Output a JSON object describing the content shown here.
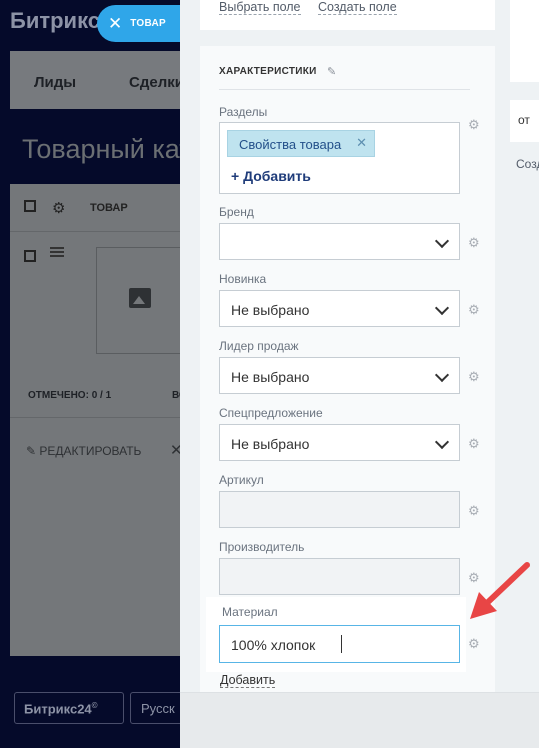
{
  "background_app": {
    "logo": "Битрикс",
    "nav_items": [
      "Лиды",
      "Сделки"
    ],
    "page_title": "Товарный кат",
    "grid": {
      "column_label": "ТОВАР",
      "marked": "ОТМЕЧЕНО: 0 / 1",
      "marked_rest": "ВС",
      "edit_label": "РЕДАКТИРОВАТЬ"
    },
    "footer": {
      "b24_label": "Битрикс24",
      "lang_label": "Русск"
    }
  },
  "close_tab": {
    "label": "ТОВАР"
  },
  "right_strip": {
    "ot_text": "от",
    "create_text": "Созд"
  },
  "top_links": {
    "select_field": "Выбрать поле",
    "create_field": "Создать поле"
  },
  "section": {
    "title": "ХАРАКТЕРИСТИКИ",
    "fields": {
      "sections": {
        "label": "Разделы",
        "tag": "Свойства товара",
        "add": "+ Добавить"
      },
      "brand": {
        "label": "Бренд",
        "value": ""
      },
      "novelty": {
        "label": "Новинка",
        "value": "Не выбрано"
      },
      "bestseller": {
        "label": "Лидер продаж",
        "value": "Не выбрано"
      },
      "special": {
        "label": "Спецпредложение",
        "value": "Не выбрано"
      },
      "article": {
        "label": "Артикул",
        "value": ""
      },
      "manufacturer": {
        "label": "Производитель",
        "value": ""
      },
      "material": {
        "label": "Материал",
        "value": "100% хлопок"
      }
    },
    "add_field": "Добавить"
  },
  "colors": {
    "accent": "#2fa6e9",
    "tag_bg": "#bfe3ef",
    "arrow": "#e84545",
    "focus_border": "#58b5e6"
  }
}
